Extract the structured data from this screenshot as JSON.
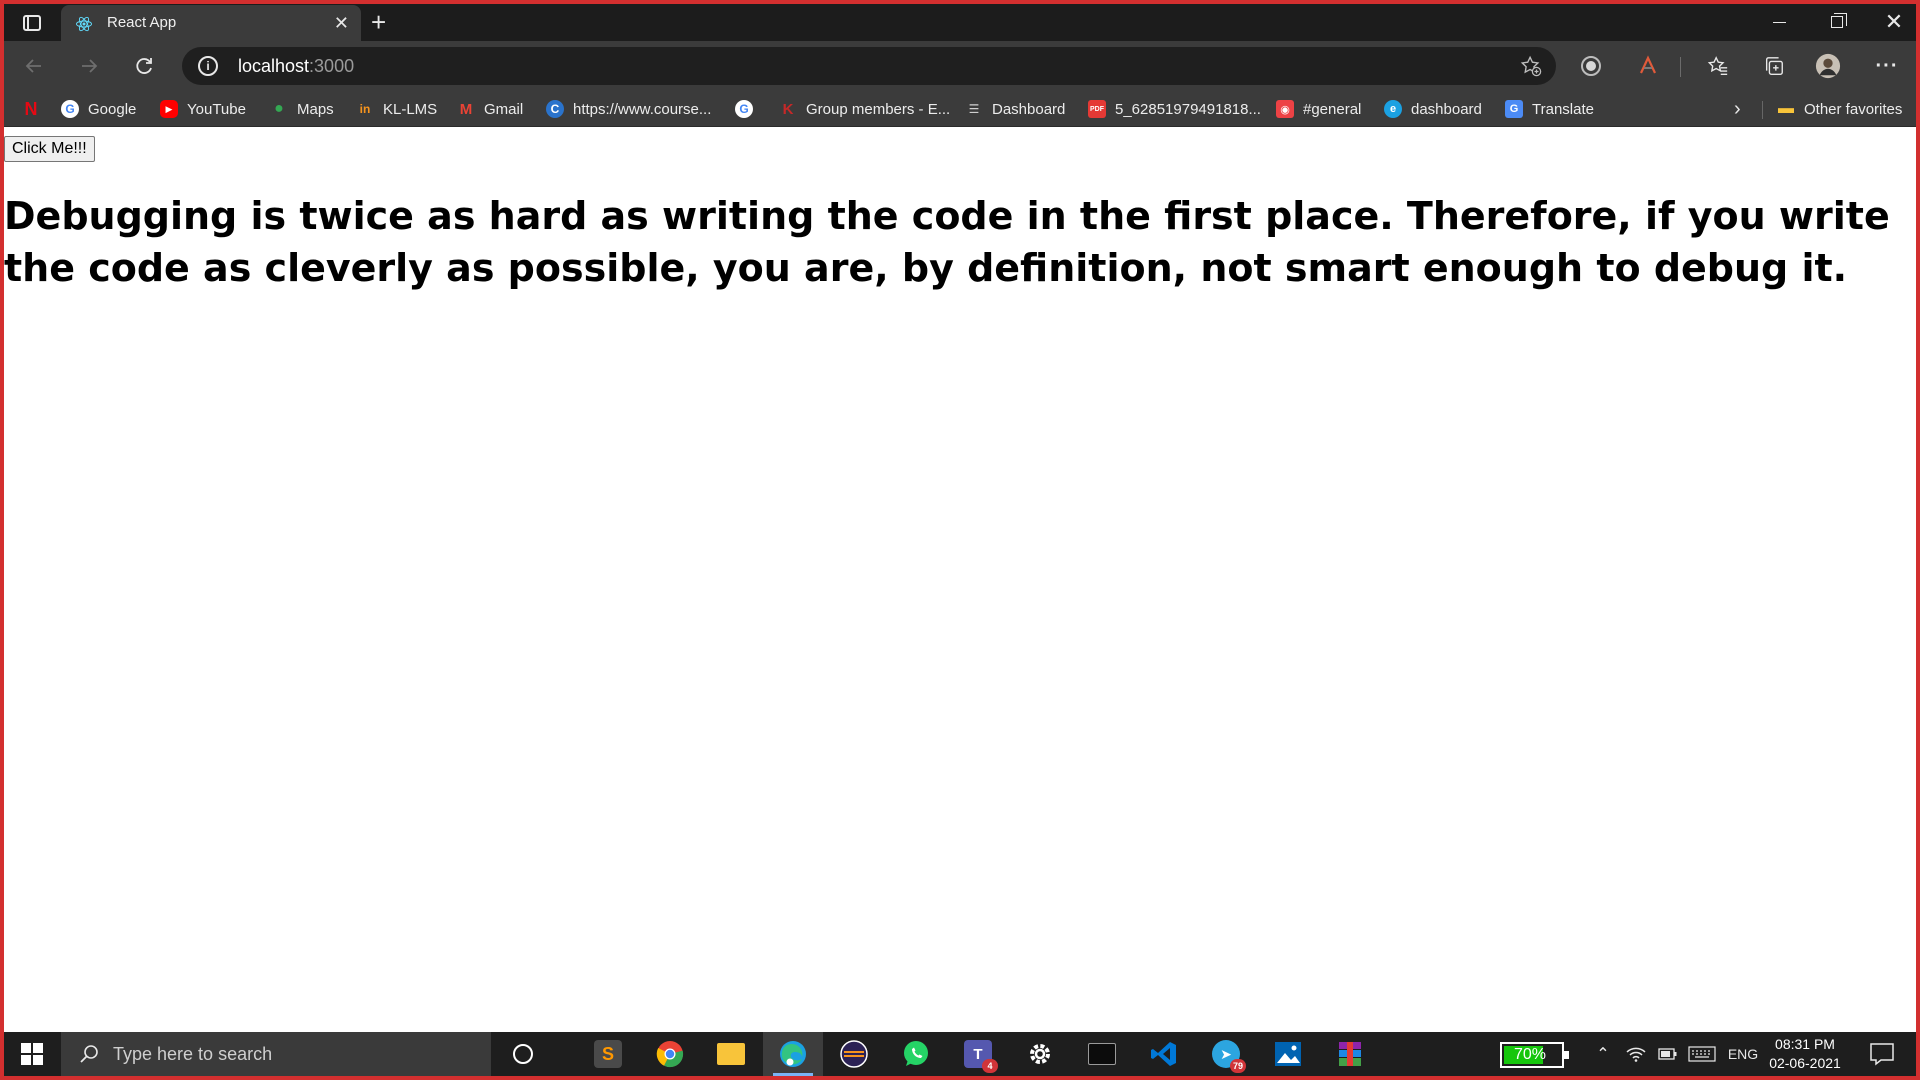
{
  "browser": {
    "tab": {
      "title": "React App",
      "favicon": "react-logo-icon"
    },
    "address": {
      "host": "localhost",
      "port": ":3000"
    },
    "favorites": [
      {
        "label": "",
        "icon": "netflix-icon",
        "color": "#e50914"
      },
      {
        "label": "Google",
        "icon": "google-icon",
        "color": "#4285f4"
      },
      {
        "label": "YouTube",
        "icon": "youtube-icon",
        "color": "#ff0000"
      },
      {
        "label": "Maps",
        "icon": "maps-icon",
        "color": "#34a853"
      },
      {
        "label": "KL-LMS",
        "icon": "kl-lms-icon",
        "color": "#f7941d"
      },
      {
        "label": "Gmail",
        "icon": "gmail-icon",
        "color": "#ea4335"
      },
      {
        "label": "https://www.course...",
        "icon": "coursera-icon",
        "color": "#2a73cc"
      },
      {
        "label": "",
        "icon": "google-icon",
        "color": "#4285f4"
      },
      {
        "label": "Group members - E...",
        "icon": "kl-university-icon",
        "color": "#c62828"
      },
      {
        "label": "Dashboard",
        "icon": "dashboard-icon",
        "color": "#9aa0a6"
      },
      {
        "label": "5_62851979491818...",
        "icon": "pdf-icon",
        "color": "#e53935"
      },
      {
        "label": "#general",
        "icon": "discord-icon",
        "color": "#ed4245"
      },
      {
        "label": "dashboard",
        "icon": "edge-icon",
        "color": "#1ba1e2"
      },
      {
        "label": "Translate",
        "icon": "translate-icon",
        "color": "#4c8bf5"
      }
    ],
    "other_favorites": "Other favorites"
  },
  "page": {
    "button_label": "Click Me!!!",
    "quote": "Debugging is twice as hard as writing the code in the first place. Therefore, if you write the code as cleverly as possible, you are, by definition, not smart enough to debug it."
  },
  "taskbar": {
    "search_placeholder": "Type here to search",
    "apps": [
      {
        "name": "cortana",
        "icon": "cortana-icon"
      },
      {
        "name": "sublime-text",
        "icon": "sublime-text-icon",
        "color": "#ff9800"
      },
      {
        "name": "chrome",
        "icon": "chrome-icon",
        "color": "#4285f4"
      },
      {
        "name": "file-explorer",
        "icon": "folder-icon",
        "color": "#f8c43a"
      },
      {
        "name": "edge",
        "icon": "edge-icon",
        "color": "#1ba1e2",
        "active": true
      },
      {
        "name": "eclipse",
        "icon": "eclipse-icon",
        "color": "#2c2255"
      },
      {
        "name": "whatsapp",
        "icon": "whatsapp-icon",
        "color": "#25d366"
      },
      {
        "name": "teams",
        "icon": "teams-icon",
        "color": "#5558af",
        "badge": "4"
      },
      {
        "name": "settings",
        "icon": "gear-icon"
      },
      {
        "name": "terminal",
        "icon": "terminal-icon"
      },
      {
        "name": "vscode",
        "icon": "vscode-icon",
        "color": "#0078d7"
      },
      {
        "name": "telegram",
        "icon": "telegram-icon",
        "color": "#2ca5e0",
        "badge": "79"
      },
      {
        "name": "photos",
        "icon": "photos-icon",
        "color": "#0063b1"
      },
      {
        "name": "winrar",
        "icon": "winrar-icon",
        "color": "#8e24aa"
      }
    ],
    "battery_percent": "70%",
    "battery_level": 0.7,
    "language": "ENG",
    "time": "08:31 PM",
    "date": "02-06-2021"
  },
  "colors": {
    "accent": "#7ab4f5",
    "frame_border": "#d32f2f"
  }
}
